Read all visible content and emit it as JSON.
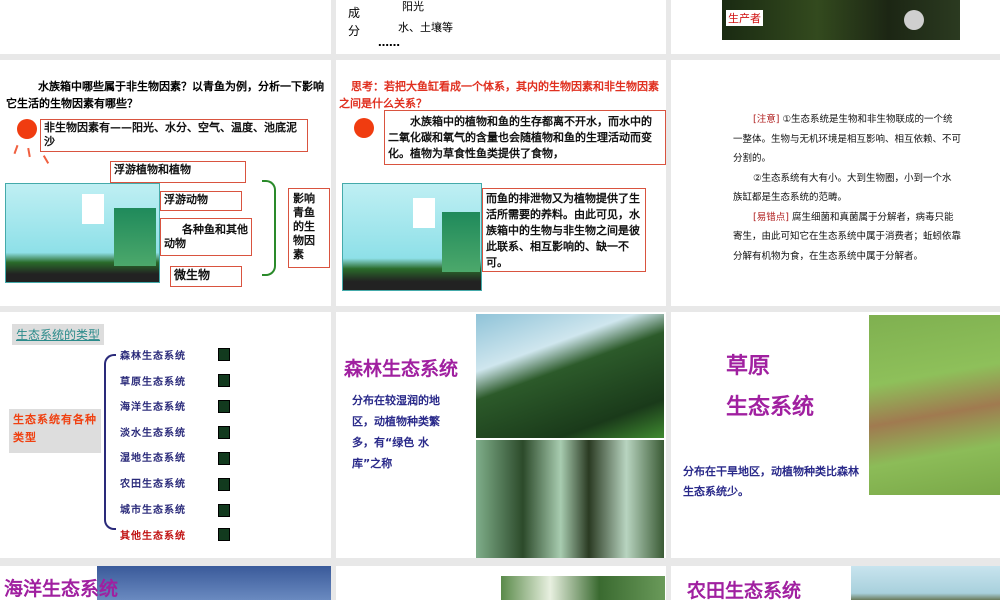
{
  "slides": [
    {
      "id": 1,
      "content": {}
    },
    {
      "id": 2,
      "content": {
        "label_cheng": "成",
        "label_fen": "分",
        "sunlight": "阳光",
        "water_soil": "水、土壤等",
        "ellipsis": "……"
      }
    },
    {
      "id": 3,
      "content": {
        "producer_label": "生产者"
      }
    },
    {
      "id": 4,
      "content": {
        "question": "水族箱中哪些属于非生物因素？以青鱼为例，分析一下影响它生活的生物因素有哪些？",
        "abiotic": "非生物因素有——阳光、水分、空气、温度、池底泥沙",
        "plankton_plants": "浮游植物和植物",
        "plankton_animals": "浮游动物",
        "fish": "各种鱼和其他动物",
        "microbes": "微生物",
        "affect": "影响青鱼的生物因素"
      }
    },
    {
      "id": 5,
      "content": {
        "question": "思考：若把大鱼缸看成一个体系，其内的生物因素和非生物因素之间是什么关系？",
        "answer1": "水族箱中的植物和鱼的生存都离不开水，而水中的二氧化碳和氧气的含量也会随植物和鱼的生理活动而变化。植物为草食性鱼类提供了食物，",
        "answer2": "而鱼的排泄物又为植物提供了生活所需要的养料。由此可见，水族箱中的生物与非生物之间是彼此联系、相互影响的、缺一不可。"
      }
    },
    {
      "id": 6,
      "content": {
        "note_tag": "[注意]",
        "note1": "①生态系统是生物和非生物联成的一个统一整体。生物与无机环境是相互影响、相互依赖、不可分割的。",
        "note2": "②生态系统有大有小。大到生物圈，小到一个水族缸都是生态系统的范畴。",
        "err_tag": "[易错点]",
        "err": "腐生细菌和真菌属于分解者，病毒只能寄生，由此可知它在生态系统中属于消费者；蚯蚓依靠分解有机物为食，在生态系统中属于分解者。"
      }
    },
    {
      "id": 7,
      "content": {
        "title": "生态系统的类型",
        "root": "生态系统有各种类型",
        "types": [
          "森林生态系统",
          "草原生态系统",
          "海洋生态系统",
          "淡水生态系统",
          "湿地生态系统",
          "农田生态系统",
          "城市生态系统",
          "其他生态系统"
        ]
      }
    },
    {
      "id": 8,
      "content": {
        "title": "森林生态系统",
        "desc": "分布在较湿润的地区，动植物种类繁多，有“绿色 水库”之称"
      }
    },
    {
      "id": 9,
      "content": {
        "title1": "草原",
        "title2": "生态系统",
        "desc": "分布在干旱地区，动植物种类比森林生态系统少。"
      }
    },
    {
      "id": 10,
      "content": {
        "title": "海洋生态系统"
      }
    },
    {
      "id": 11,
      "content": {}
    },
    {
      "id": 12,
      "content": {
        "title": "农田生态系统"
      }
    }
  ]
}
